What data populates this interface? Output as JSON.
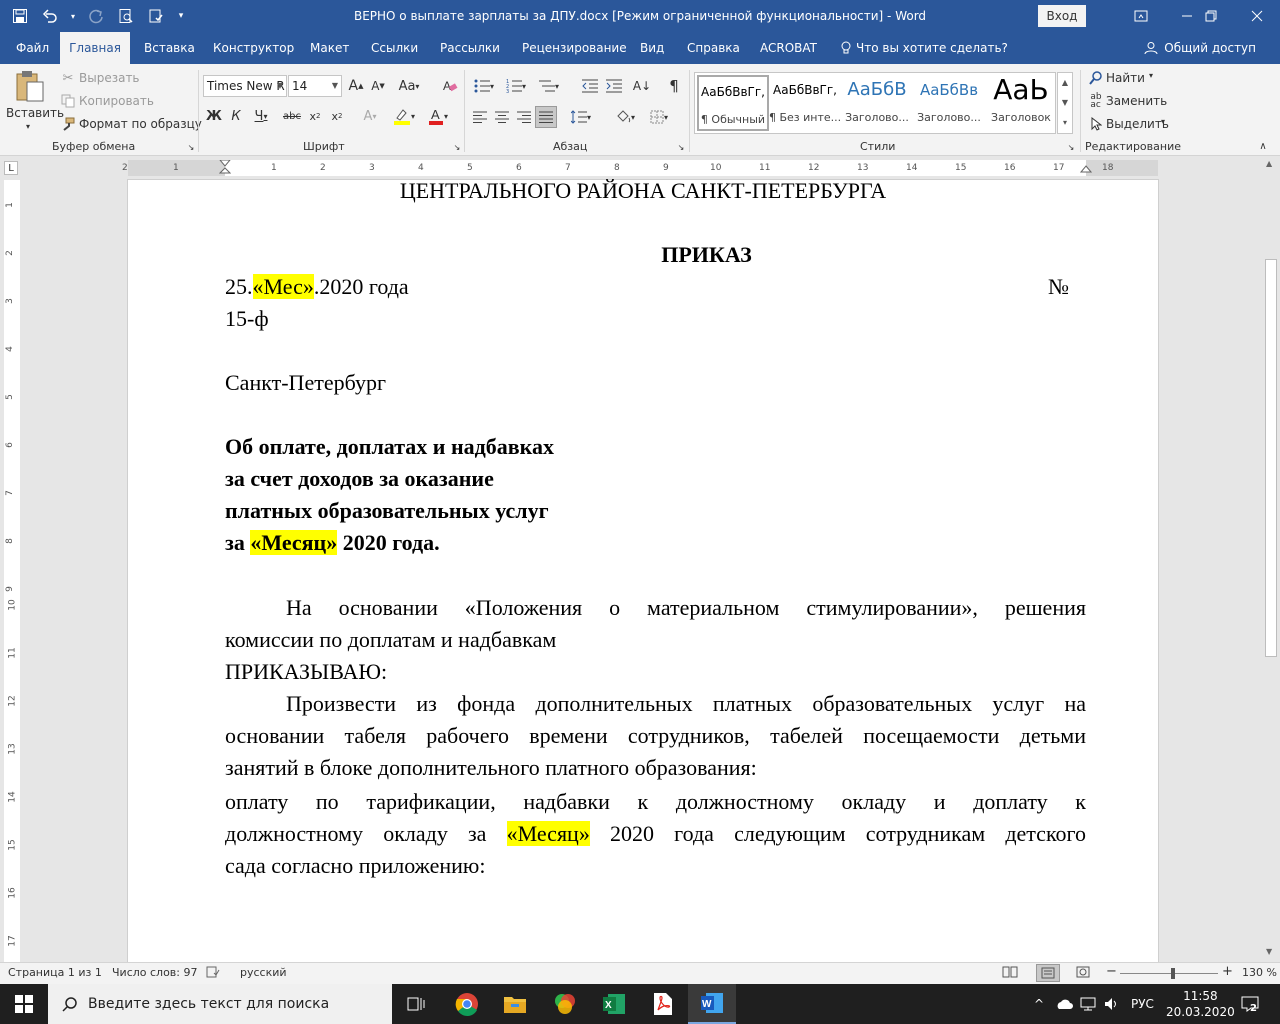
{
  "window": {
    "title": "ВЕРНО о выплате зарплаты за ДПУ.docx [Режим ограниченной функциональности]  -  Word",
    "login_label": "Вход"
  },
  "ribbon_tabs": [
    "Файл",
    "Главная",
    "Вставка",
    "Конструктор",
    "Макет",
    "Ссылки",
    "Рассылки",
    "Рецензирование",
    "Вид",
    "Справка",
    "ACROBAT"
  ],
  "tell_me": "Что вы хотите сделать?",
  "share_label": "Общий доступ",
  "clipboard": {
    "paste": "Вставить",
    "cut": "Вырезать",
    "copy": "Копировать",
    "format_painter": "Формат по образцу",
    "group_label": "Буфер обмена"
  },
  "font": {
    "name": "Times New R",
    "size": "14",
    "group_label": "Шрифт"
  },
  "paragraph": {
    "group_label": "Абзац"
  },
  "styles": {
    "group_label": "Стили",
    "items": [
      {
        "sample": "АаБбВвГг,",
        "name": "¶ Обычный"
      },
      {
        "sample": "АаБбВвГг,",
        "name": "¶ Без инте..."
      },
      {
        "sample": "АаБбВ",
        "name": "Заголово..."
      },
      {
        "sample": "АаБбВв",
        "name": "Заголово..."
      },
      {
        "sample": "АаЬ",
        "name": "Заголовок"
      }
    ]
  },
  "editing": {
    "find": "Найти",
    "replace": "Заменить",
    "select": "Выделить",
    "group_label": "Редактирование"
  },
  "ruler": {
    "h_numbers": [
      "2",
      "1",
      "1",
      "2",
      "3",
      "4",
      "5",
      "6",
      "7",
      "8",
      "9",
      "10",
      "11",
      "12",
      "13",
      "14",
      "15",
      "16",
      "17",
      "18"
    ],
    "v_numbers": [
      "1",
      "2",
      "3",
      "4",
      "5",
      "6",
      "7",
      "8",
      "9",
      "10",
      "11",
      "12",
      "13",
      "14",
      "15",
      "16",
      "17"
    ]
  },
  "document": {
    "header_line": "ЦЕНТРАЛЬНОГО РАЙОНА САНКТ-ПЕТЕРБУРГА",
    "order_title": "ПРИКАЗ",
    "date_prefix": "25.",
    "date_field": "«Мес»",
    "date_suffix": ".2020 года",
    "number_sign": "№",
    "number": "15-ф",
    "city": "Санкт-Петербург",
    "subject_1": "Об оплате,  доплатах и надбавках",
    "subject_2": "за счет доходов за оказание",
    "subject_3": "платных образовательных услуг",
    "subject_4_prefix": "за ",
    "subject_4_field": "«Месяц»",
    "subject_4_suffix": " 2020 года.",
    "para1_line1": "На основании «Положения о материальном стимулировании», решения",
    "para1_line2": "комиссии по доплатам и надбавкам",
    "order_word": "ПРИКАЗЫВАЮ:",
    "para2_line1": "Произвести из  фонда дополнительных платных образовательных услуг на",
    "para2_line2": "основании табеля рабочего времени сотрудников, табелей посещаемости детьми",
    "para2_line3": "занятий в блоке дополнительного платного образования:",
    "para3_line1": "оплату по тарификации, надбавки к должностному окладу и доплату к",
    "para3_line2_prefix": "должностному окладу за ",
    "para3_line2_field": "«Месяц»",
    "para3_line2_suffix": " 2020 года следующим сотрудникам детского",
    "para3_line3": "сада согласно приложению:"
  },
  "status_bar": {
    "page": "Страница 1 из 1",
    "words": "Число слов: 97",
    "language": "русский",
    "zoom": "130 %"
  },
  "taskbar": {
    "search_placeholder": "Введите здесь текст для поиска",
    "lang": "РУС",
    "time": "11:58",
    "date": "20.03.2020",
    "notifications": "2"
  },
  "colors": {
    "word_blue": "#2b579a",
    "highlight": "#ffff00"
  }
}
